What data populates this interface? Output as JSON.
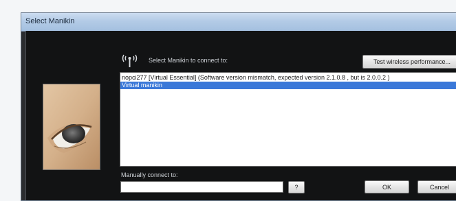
{
  "window": {
    "title": "Select Manikin"
  },
  "dialog": {
    "connect_label": "Select Manikin to connect to:",
    "test_button": "Test wireless performance...",
    "manikins": [
      "nopci277 [Virtual Essential] (Software version mismatch, expected version 2.1.0.8 , but is 2.0.0.2 )",
      "Virtual manikin"
    ],
    "selected_index": 1,
    "manual_label": "Manually connect to:",
    "manual_value": "",
    "help_button": "?",
    "ok_button": "OK",
    "cancel_button": "Cancel"
  },
  "colors": {
    "selection": "#3a78d8",
    "dialog_background": "#121314",
    "title_bar": "#b3cbe6"
  },
  "icons": {
    "connection": "wireless-antenna-icon",
    "preview": "mannequin-eye-image"
  }
}
